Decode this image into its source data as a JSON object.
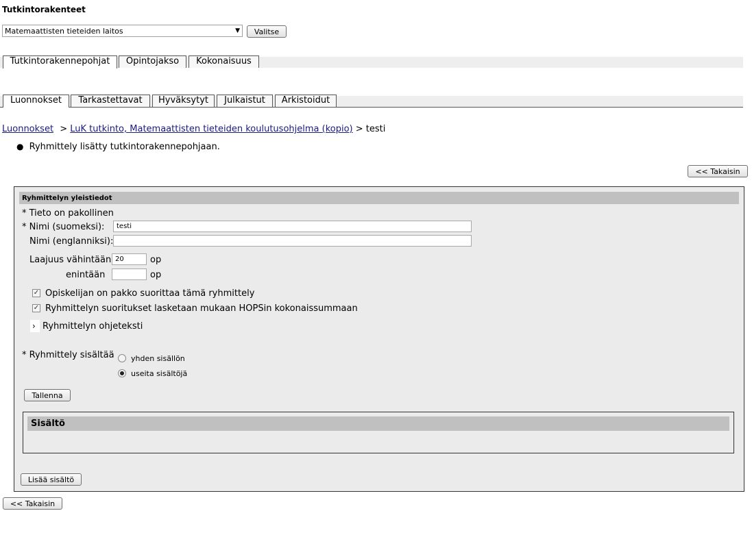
{
  "page_title": "Tutkintorakenteet",
  "department": {
    "selected": "Matemaattisten tieteiden laitos",
    "select_button": "Valitse"
  },
  "main_tabs": [
    "Tutkintorakennepohjat",
    "Opintojakso",
    "Kokonaisuus"
  ],
  "status_tabs": [
    "Luonnokset",
    "Tarkastettavat",
    "Hyväksytyt",
    "Julkaistut",
    "Arkistoidut"
  ],
  "breadcrumb": {
    "level1": "Luonnokset",
    "sep1": ">",
    "level2": "LuK tutkinto, Matemaattisten tieteiden koulutusohjelma (kopio)",
    "sep2": ">",
    "current": "testi"
  },
  "message": "Ryhmittely lisätty tutkintorakennepohjaan.",
  "back_button": "<< Takaisin",
  "form": {
    "section_title": "Ryhmittelyn yleistiedot",
    "required_note": "* Tieto on pakollinen",
    "name_fi_label": "* Nimi (suomeksi):",
    "name_fi_value": "testi",
    "name_en_label": "Nimi (englanniksi):",
    "name_en_value": "",
    "min_label": "Laajuus vähintään",
    "min_value": "20",
    "max_label": "enintään",
    "max_value": "",
    "unit": "op",
    "mandatory_label": "Opiskelijan on pakko suorittaa tämä ryhmittely",
    "mandatory_checked": true,
    "hops_label": "Ryhmittelyn suoritukset lasketaan mukaan HOPSin kokonaissummaan",
    "hops_checked": true,
    "instructions_label": "Ryhmittelyn ohjeteksti",
    "contains_label": "* Ryhmittely sisältää",
    "option_one": "yhden sisällön",
    "option_many": "useita sisältöjä",
    "selected_option": "many",
    "save_button": "Tallenna",
    "content_title": "Sisältö",
    "add_content_button": "Lisää sisältö"
  }
}
